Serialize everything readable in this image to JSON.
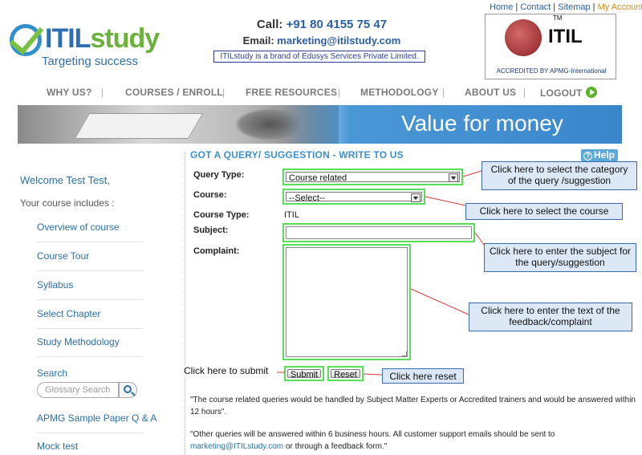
{
  "header": {
    "logo_main": "ITIL",
    "logo_study": "study",
    "tagline": "Targeting success",
    "call_label": "Call:",
    "call_number": "+91 80 4155 75 47",
    "email_label": "Email:",
    "email_address": "marketing@itilstudy.com",
    "brand_line": "ITILstudy is a brand of Edusys Services Private Limited.",
    "top_links": [
      "Home",
      "Contact",
      "Sitemap",
      "My Account"
    ],
    "badge": {
      "tm": "TM",
      "text": "ITIL",
      "accredited": "ACCREDITED BY  APMG-International"
    }
  },
  "nav": {
    "items": [
      "WHY US?",
      "COURSES / ENROLL",
      "FREE RESOURCES",
      "METHODOLOGY",
      "ABOUT US",
      "LOGOUT"
    ],
    "separator": "|"
  },
  "banner": {
    "text": "Value for money"
  },
  "sidebar": {
    "welcome": "Welcome Test Test,",
    "includes": "Your course includes :",
    "items": [
      "Overview of course",
      "Course Tour",
      "Syllabus",
      "Select Chapter",
      "Study Methodology"
    ],
    "search_label": "Search",
    "search_placeholder": "Glossary Search",
    "more_items": [
      "APMG Sample Paper Q & A",
      "Mock test"
    ]
  },
  "form": {
    "heading": "GOT A QUERY/ SUGGESTION - WRITE TO US",
    "help_label": "Help",
    "query_type_label": "Query Type:",
    "query_type_value": "Course related",
    "course_label": "Course:",
    "course_value": "--Select--",
    "course_type_label": "Course Type:",
    "course_type_value": "ITIL",
    "subject_label": "Subject:",
    "subject_value": "",
    "complaint_label": "Complaint:",
    "complaint_value": "",
    "submit_label": "Submit",
    "reset_label": "Reset",
    "note1": "\"The course related queries would be handled by Subject Matter Experts or Accredited trainers and would be answered within 12 hours\".",
    "note2_part1": "\"Other queries will be answered within 6 business hours. All customer support emails should be sent to",
    "note2_email": "marketing@ITILstudy.com",
    "note2_part2": " or through a feedback form.\""
  },
  "callouts": {
    "query_type": "Click here to select the category of the query /suggestion",
    "course": "Click here to select the course",
    "subject": "Click here to enter the subject for the query/suggestion",
    "complaint": "Click here to enter the text of the feedback/complaint",
    "submit": "Click here to submit",
    "reset": "Click here reset"
  },
  "colors": {
    "accent": "#3d8fd0",
    "highlight": "#55e055",
    "callout_fill": "#dce8f6",
    "link": "#2b6fa8"
  }
}
